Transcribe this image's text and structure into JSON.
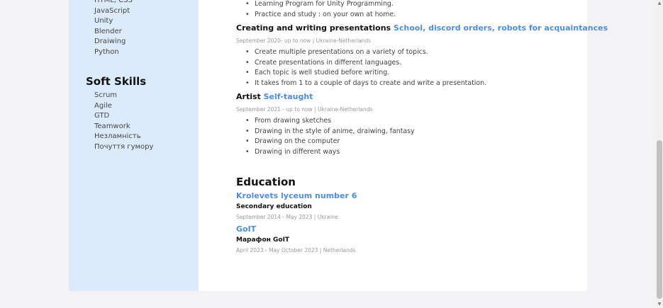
{
  "sidebar": {
    "tech_items": [
      "HTML, CSS",
      "JavaScript",
      "Unity",
      "Blender",
      "Draiwing",
      "Python"
    ],
    "soft_title": "Soft Skills",
    "soft_items": [
      "Scrum",
      "Agile",
      "GTD",
      "Teamwork",
      "Незламність",
      "Почуття гумору"
    ]
  },
  "main": {
    "top_bullets": [
      "Learning Program for Unity Programming.",
      "Practice and study : on your own at home."
    ],
    "job1": {
      "title": "Creating and writing presentations",
      "accent": "School, discord orders, robots for acquaintances",
      "meta": "September 2020- up to now | Ukraine-Netherlands",
      "bullets": [
        "Create multiple presentations on a variety of topics.",
        "Create presentations in different languages.",
        "Each topic is well studied before writing.",
        "It takes from 1 to a couple of days to create and write a presentation."
      ]
    },
    "job2": {
      "title": "Artist",
      "accent": "Self-taught",
      "meta": "September 2021 - up to now | Ukraine-Netherlands",
      "bullets": [
        "From drawing sketches",
        "Drawing in the style of anime, draiwing, fantasy",
        "Drawing on the computer",
        "Drawing in different ways"
      ]
    },
    "education": {
      "title": "Education",
      "items": [
        {
          "school": "Krolevets lyceum number 6",
          "degree": "Secondary education",
          "meta": "September 2014 - May 2023 | Ukraine"
        },
        {
          "school": "GoIT",
          "degree": "Марафон GoIT",
          "meta": "April 2023 - May October 2023 | Netherlands"
        }
      ]
    }
  },
  "scrollbar": {
    "up_icon": "triangle-up-icon",
    "down_icon": "triangle-down-icon"
  }
}
